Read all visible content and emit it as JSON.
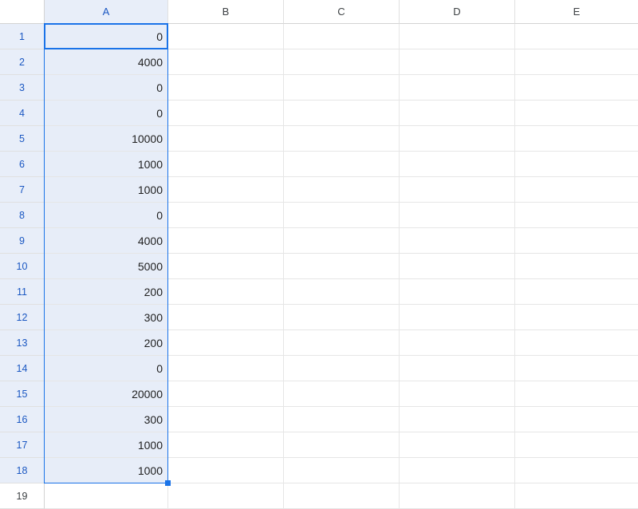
{
  "columns": [
    "A",
    "B",
    "C",
    "D",
    "E"
  ],
  "rows": [
    1,
    2,
    3,
    4,
    5,
    6,
    7,
    8,
    9,
    10,
    11,
    12,
    13,
    14,
    15,
    16,
    17,
    18,
    19
  ],
  "selected_column_index": 0,
  "selected_row_start": 1,
  "selected_row_end": 18,
  "active_row": 1,
  "cells": {
    "A": [
      "0",
      "4000",
      "0",
      "0",
      "10000",
      "1000",
      "1000",
      "0",
      "4000",
      "5000",
      "200",
      "300",
      "200",
      "0",
      "20000",
      "300",
      "1000",
      "1000",
      ""
    ],
    "B": [
      "",
      "",
      "",
      "",
      "",
      "",
      "",
      "",
      "",
      "",
      "",
      "",
      "",
      "",
      "",
      "",
      "",
      "",
      ""
    ],
    "C": [
      "",
      "",
      "",
      "",
      "",
      "",
      "",
      "",
      "",
      "",
      "",
      "",
      "",
      "",
      "",
      "",
      "",
      "",
      ""
    ],
    "D": [
      "",
      "",
      "",
      "",
      "",
      "",
      "",
      "",
      "",
      "",
      "",
      "",
      "",
      "",
      "",
      "",
      "",
      "",
      ""
    ],
    "E": [
      "",
      "",
      "",
      "",
      "",
      "",
      "",
      "",
      "",
      "",
      "",
      "",
      "",
      "",
      "",
      "",
      "",
      "",
      ""
    ]
  }
}
